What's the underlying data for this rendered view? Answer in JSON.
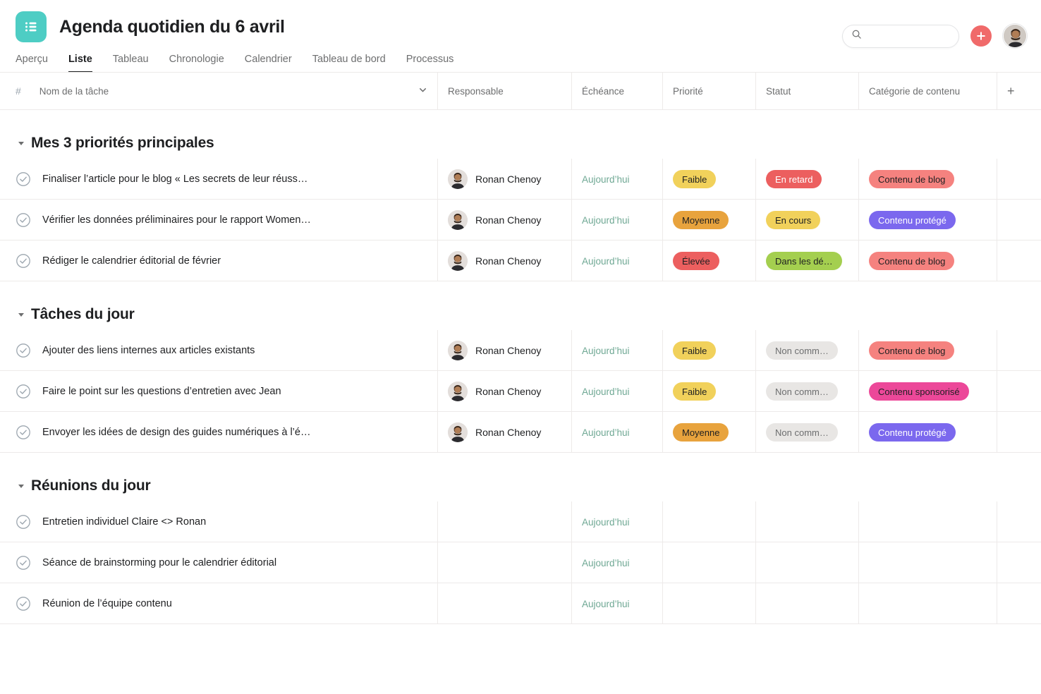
{
  "header": {
    "app_icon": "list-icon",
    "title": "Agenda quotidien du 6 avril",
    "search": {
      "placeholder": "",
      "value": "",
      "icon": "search-icon"
    },
    "add_button_label": "+",
    "avatar": "user-avatar"
  },
  "tabs": [
    {
      "label": "Aperçu",
      "active": false
    },
    {
      "label": "Liste",
      "active": true
    },
    {
      "label": "Tableau",
      "active": false
    },
    {
      "label": "Chronologie",
      "active": false
    },
    {
      "label": "Calendrier",
      "active": false
    },
    {
      "label": "Tableau de bord",
      "active": false
    },
    {
      "label": "Processus",
      "active": false
    }
  ],
  "columns": {
    "index": "#",
    "name": "Nom de la tâche",
    "assignee": "Responsable",
    "due": "Échéance",
    "priority": "Priorité",
    "status": "Statut",
    "category": "Catégorie de contenu",
    "add": "+"
  },
  "colors": {
    "accent_teal": "#4ecdc4",
    "add_red": "#f06a6a",
    "due_green": "#6fa894",
    "pill_yellow": "#f1d15b",
    "pill_orange": "#e8a33d",
    "pill_red": "#ec5f5f",
    "pill_green": "#a4cf4f",
    "pill_grey": "#e8e6e4",
    "pill_pink": "#f5827f",
    "pill_purple": "#7b68ee",
    "pill_magenta": "#ec4899"
  },
  "sections": [
    {
      "title": "Mes 3 priorités principales",
      "expanded": true,
      "tasks": [
        {
          "name": "Finaliser l’article pour le blog « Les secrets de leur réuss…",
          "assignee": "Ronan Chenoy",
          "due": "Aujourd’hui",
          "priority": {
            "label": "Faible",
            "bg": "#f1d15b",
            "fg": "#1e1f21"
          },
          "status": {
            "label": "En retard",
            "bg": "#ec5f5f",
            "fg": "#ffffff"
          },
          "category": {
            "label": "Contenu de blog",
            "bg": "#f5827f",
            "fg": "#1e1f21"
          }
        },
        {
          "name": "Vérifier les données préliminaires pour le rapport Women…",
          "assignee": "Ronan Chenoy",
          "due": "Aujourd’hui",
          "priority": {
            "label": "Moyenne",
            "bg": "#e8a33d",
            "fg": "#1e1f21"
          },
          "status": {
            "label": "En cours",
            "bg": "#f1d15b",
            "fg": "#1e1f21"
          },
          "category": {
            "label": "Contenu protégé",
            "bg": "#7b68ee",
            "fg": "#ffffff"
          }
        },
        {
          "name": "Rédiger le calendrier éditorial de février",
          "assignee": "Ronan Chenoy",
          "due": "Aujourd’hui",
          "priority": {
            "label": "Élevée",
            "bg": "#ec5f5f",
            "fg": "#1e1f21"
          },
          "status": {
            "label": "Dans les dé…",
            "bg": "#a4cf4f",
            "fg": "#1e1f21"
          },
          "category": {
            "label": "Contenu de blog",
            "bg": "#f5827f",
            "fg": "#1e1f21"
          }
        }
      ]
    },
    {
      "title": "Tâches du jour",
      "expanded": true,
      "tasks": [
        {
          "name": "Ajouter des liens internes aux articles existants",
          "assignee": "Ronan Chenoy",
          "due": "Aujourd’hui",
          "priority": {
            "label": "Faible",
            "bg": "#f1d15b",
            "fg": "#1e1f21"
          },
          "status": {
            "label": "Non comm…",
            "bg": "#e8e6e4",
            "fg": "#6d6e6f"
          },
          "category": {
            "label": "Contenu de blog",
            "bg": "#f5827f",
            "fg": "#1e1f21"
          }
        },
        {
          "name": "Faire le point sur les questions d’entretien avec Jean",
          "assignee": "Ronan Chenoy",
          "due": "Aujourd’hui",
          "priority": {
            "label": "Faible",
            "bg": "#f1d15b",
            "fg": "#1e1f21"
          },
          "status": {
            "label": "Non comm…",
            "bg": "#e8e6e4",
            "fg": "#6d6e6f"
          },
          "category": {
            "label": "Contenu sponsorisé",
            "bg": "#ec4899",
            "fg": "#1e1f21"
          }
        },
        {
          "name": "Envoyer les idées de design des guides numériques à l’é…",
          "assignee": "Ronan Chenoy",
          "due": "Aujourd’hui",
          "priority": {
            "label": "Moyenne",
            "bg": "#e8a33d",
            "fg": "#1e1f21"
          },
          "status": {
            "label": "Non comm…",
            "bg": "#e8e6e4",
            "fg": "#6d6e6f"
          },
          "category": {
            "label": "Contenu protégé",
            "bg": "#7b68ee",
            "fg": "#ffffff"
          }
        }
      ]
    },
    {
      "title": "Réunions du jour",
      "expanded": true,
      "tasks": [
        {
          "name": "Entretien individuel Claire <> Ronan",
          "assignee": "",
          "due": "Aujourd’hui",
          "priority": null,
          "status": null,
          "category": null
        },
        {
          "name": "Séance de brainstorming pour le calendrier éditorial",
          "assignee": "",
          "due": "Aujourd’hui",
          "priority": null,
          "status": null,
          "category": null
        },
        {
          "name": "Réunion de l’équipe contenu",
          "assignee": "",
          "due": "Aujourd’hui",
          "priority": null,
          "status": null,
          "category": null
        }
      ]
    }
  ]
}
